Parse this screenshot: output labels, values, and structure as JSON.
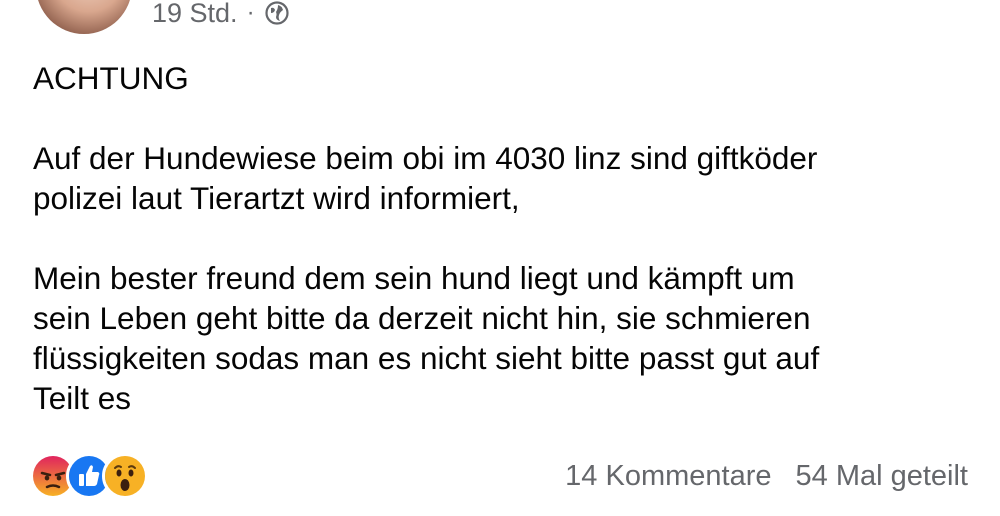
{
  "post": {
    "time": "19 Std.",
    "separator": "·",
    "visibility_icon": "globe-icon",
    "paragraphs": [
      "ACHTUNG",
      "Auf der Hundewiese beim obi im 4030 linz sind giftköder\npolizei laut Tierartzt wird informiert,",
      "Mein bester freund dem sein hund liegt und kämpft um\nsein Leben geht bitte da derzeit nicht hin, sie schmieren\nflüssigkeiten sodas man es nicht sieht bitte passt gut auf\nTeilt es"
    ]
  },
  "reactions": {
    "icons": [
      "angry-reaction-icon",
      "like-reaction-icon",
      "wow-reaction-icon"
    ],
    "colors": {
      "angry": "#e9710f",
      "like": "#1877f2",
      "wow": "#f7b125"
    }
  },
  "stats": {
    "comments": "14 Kommentare",
    "shares": "54 Mal geteilt"
  }
}
